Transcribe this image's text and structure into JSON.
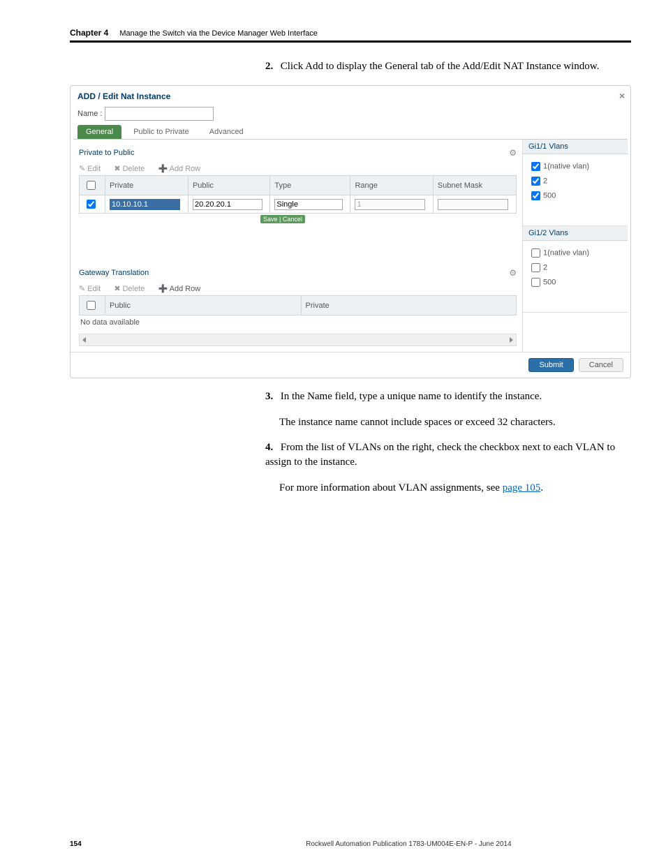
{
  "header": {
    "chapter_label": "Chapter 4",
    "chapter_title": "Manage the Switch via the Device Manager Web Interface"
  },
  "steps": {
    "s2_num": "2.",
    "s2_text": "Click Add to display the General tab of the Add/Edit NAT Instance window.",
    "s3_num": "3.",
    "s3_text": "In the Name field, type a unique name to identify the instance.",
    "s3_sub": "The instance name cannot include spaces or exceed 32 characters.",
    "s4_num": "4.",
    "s4_text": "From the list of VLANs on the right, check the checkbox next to each VLAN to assign to the instance.",
    "s4_sub_prefix": "For more information about VLAN assignments, see ",
    "s4_sub_link": "page 105",
    "s4_sub_suffix": "."
  },
  "dialog": {
    "title": "ADD / Edit Nat Instance",
    "close": "×",
    "name_label": "Name :",
    "tabs": {
      "general": "General",
      "p2priv": "Public to Private",
      "advanced": "Advanced"
    },
    "priv2pub": {
      "title": "Private to Public",
      "toolbar": {
        "edit": "Edit",
        "del": "Delete",
        "add": "Add Row"
      },
      "cols": {
        "c0": "",
        "c1": "Private",
        "c2": "Public",
        "c3": "Type",
        "c4": "Range",
        "c5": "Subnet Mask"
      },
      "row": {
        "private": "10.10.10.1",
        "public": "20.20.20.1",
        "type": "Single",
        "range": "1"
      },
      "savecancel": "Save | Cancel"
    },
    "gateway": {
      "title": "Gateway Translation",
      "toolbar": {
        "edit": "Edit",
        "del": "Delete",
        "add": "Add Row"
      },
      "cols": {
        "c0": "",
        "c1": "Public",
        "c2": "Private"
      },
      "nodata": "No data available"
    },
    "vlans": {
      "g1": "Gi1/1 Vlans",
      "g1_items": {
        "a": "1(native vlan)",
        "b": "2",
        "c": "500"
      },
      "g2": "Gi1/2 Vlans",
      "g2_items": {
        "a": "1(native vlan)",
        "b": "2",
        "c": "500"
      }
    },
    "buttons": {
      "submit": "Submit",
      "cancel": "Cancel"
    }
  },
  "footer": {
    "page": "154",
    "pub": "Rockwell Automation Publication 1783-UM004E-EN-P - June 2014"
  }
}
